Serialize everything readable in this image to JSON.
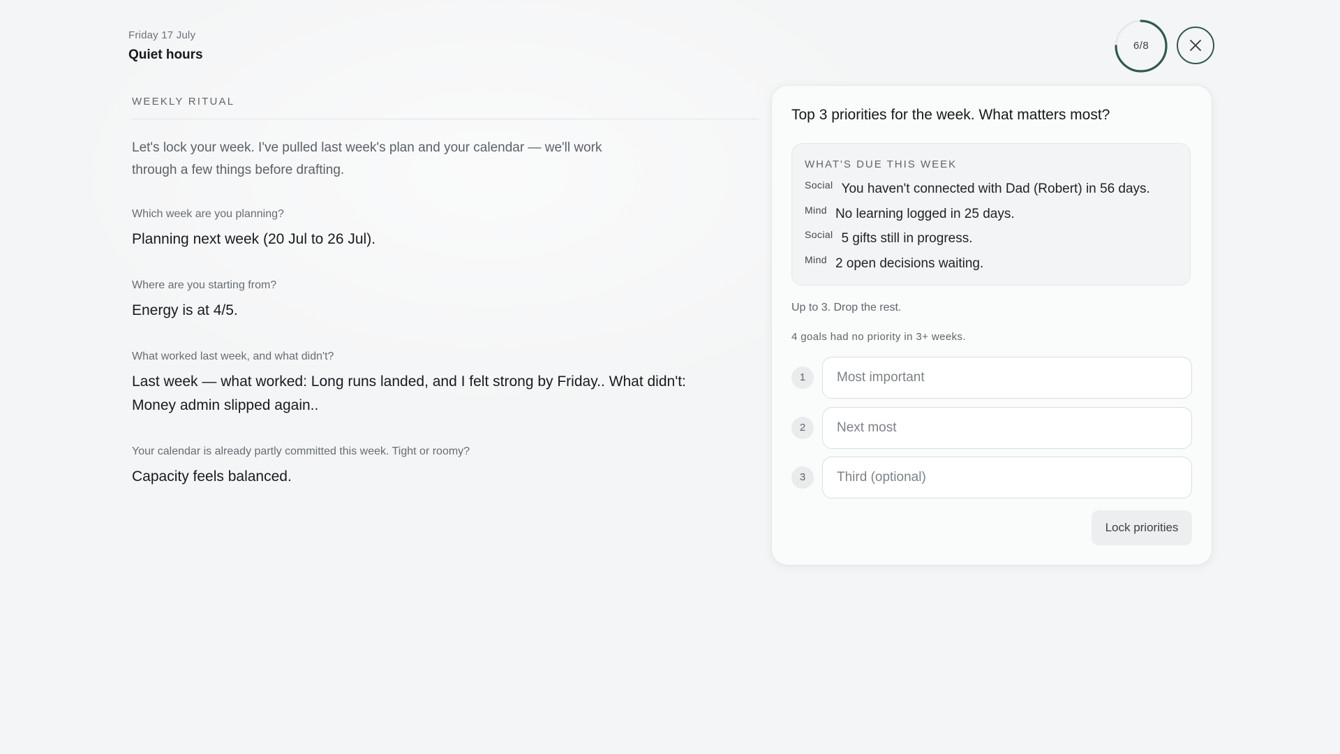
{
  "header": {
    "date": "Friday 17 July",
    "title": "Quiet hours"
  },
  "progress": {
    "label": "6/8",
    "current": 6,
    "total": 8,
    "ring_color": "#2f5a4a"
  },
  "close_icon": "close-icon",
  "conversation": {
    "section_label": "WEEKLY RITUAL",
    "intro": "Let's lock your week. I've pulled last week's plan and your calendar — we'll work through a few things before drafting.",
    "qa": [
      {
        "question": "Which week are you planning?",
        "answer": "Planning next week (20 Jul to 26 Jul)."
      },
      {
        "question": "Where are you starting from?",
        "answer": "Energy is at 4/5."
      },
      {
        "question": "What worked last week, and what didn't?",
        "answer": "Last week — what worked: Long runs landed, and I felt strong by Friday.. What didn't: Money admin slipped again.."
      },
      {
        "question": "Your calendar is already partly committed this week. Tight or roomy?",
        "answer": "Capacity feels balanced."
      }
    ]
  },
  "card": {
    "title": "Top 3 priorities for the week. What matters most?",
    "due": {
      "heading": "WHAT'S DUE THIS WEEK",
      "items": [
        {
          "tag": "Social",
          "text": "You haven't connected with Dad (Robert) in 56 days."
        },
        {
          "tag": "Mind",
          "text": "No learning logged in 25 days."
        },
        {
          "tag": "Social",
          "text": "5 gifts still in progress."
        },
        {
          "tag": "Mind",
          "text": "2 open decisions waiting."
        }
      ]
    },
    "hint": "Up to 3. Drop the rest.",
    "subhint": "4 goals had no priority in 3+ weeks.",
    "priorities": [
      {
        "number": "1",
        "placeholder": "Most important",
        "value": ""
      },
      {
        "number": "2",
        "placeholder": "Next most",
        "value": ""
      },
      {
        "number": "3",
        "placeholder": "Third (optional)",
        "value": ""
      }
    ],
    "lock_button": "Lock priorities"
  }
}
